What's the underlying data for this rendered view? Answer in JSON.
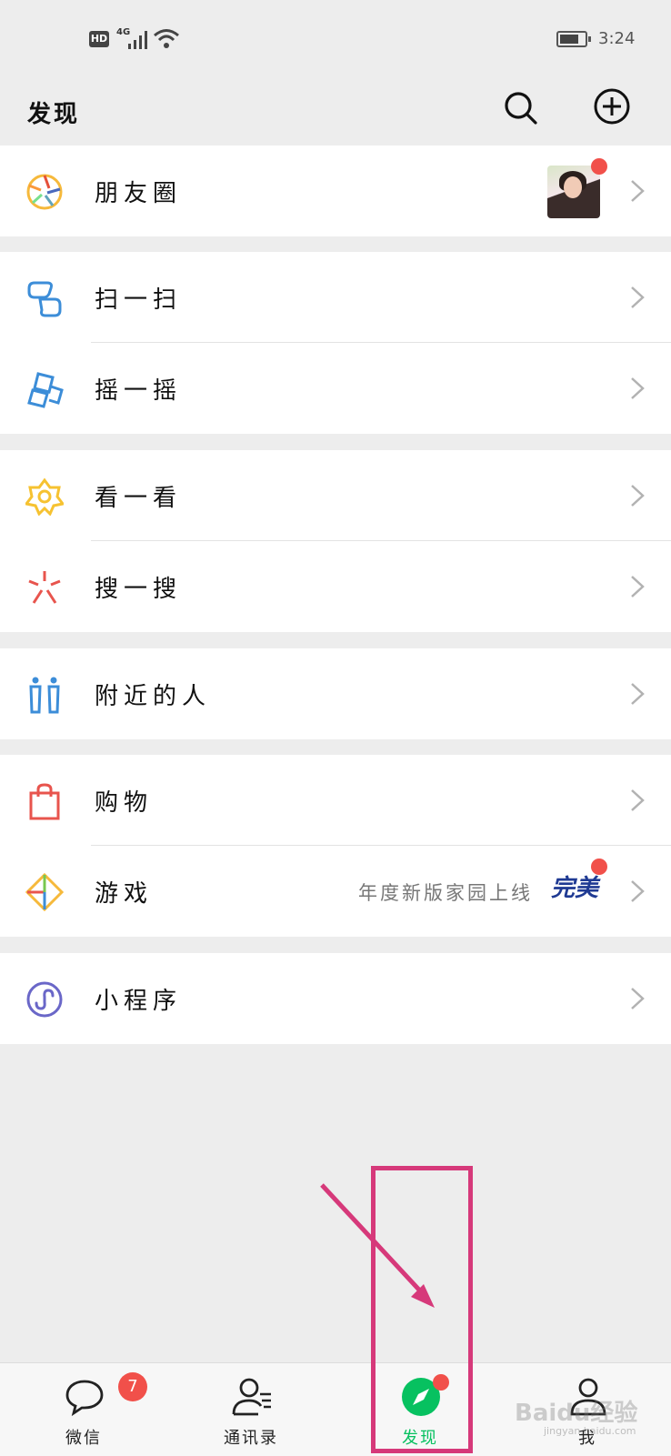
{
  "status_bar": {
    "hd": "HD",
    "network": "4G",
    "time": "3:24"
  },
  "header": {
    "title": "发现"
  },
  "items": {
    "moments": {
      "label": "朋友圈"
    },
    "scan": {
      "label": "扫一扫"
    },
    "shake": {
      "label": "摇一摇"
    },
    "top_stories": {
      "label": "看一看"
    },
    "search": {
      "label": "搜一搜"
    },
    "nearby": {
      "label": "附近的人"
    },
    "shopping": {
      "label": "购物"
    },
    "games": {
      "label": "游戏",
      "promo": "年度新版家园上线",
      "logo_text": "完美"
    },
    "mini_programs": {
      "label": "小程序"
    }
  },
  "tabbar": {
    "chats": {
      "label": "微信",
      "badge": "7"
    },
    "contacts": {
      "label": "通讯录"
    },
    "discover": {
      "label": "发现"
    },
    "me": {
      "label": "我"
    }
  },
  "watermark": {
    "text": "Baidu经验",
    "sub": "jingyan.baidu.com"
  },
  "colors": {
    "accent_green": "#07c160",
    "badge_red": "#f1504a",
    "annotation_pink": "#d6397a"
  }
}
